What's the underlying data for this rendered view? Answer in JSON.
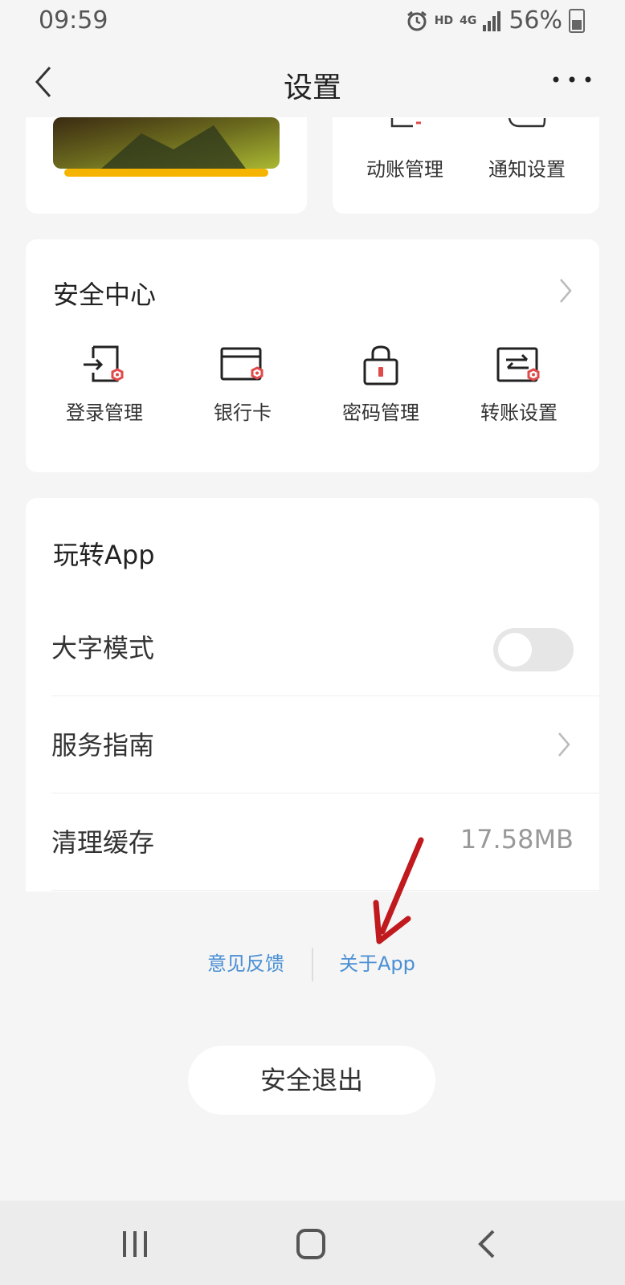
{
  "status_bar": {
    "time": "09:59",
    "hd": "HD",
    "network": "4G",
    "battery": "56%"
  },
  "header": {
    "title": "设置"
  },
  "top_cards": {
    "right_items": [
      {
        "label": "动账管理"
      },
      {
        "label": "通知设置"
      }
    ]
  },
  "security_center": {
    "title": "安全中心",
    "items": [
      {
        "label": "登录管理"
      },
      {
        "label": "银行卡"
      },
      {
        "label": "密码管理"
      },
      {
        "label": "转账设置"
      }
    ]
  },
  "play_app": {
    "title": "玩转App",
    "rows": {
      "large_font": {
        "label": "大字模式",
        "toggle_on": false
      },
      "service_guide": {
        "label": "服务指南"
      },
      "clear_cache": {
        "label": "清理缓存",
        "value": "17.58MB"
      }
    }
  },
  "links": {
    "feedback": "意见反馈",
    "about": "关于App"
  },
  "logout": {
    "label": "安全退出"
  },
  "colors": {
    "accent": "#4a8fd4",
    "background": "#f5f5f5",
    "icon_red": "#e04a4a",
    "arrow": "#c0191e"
  }
}
